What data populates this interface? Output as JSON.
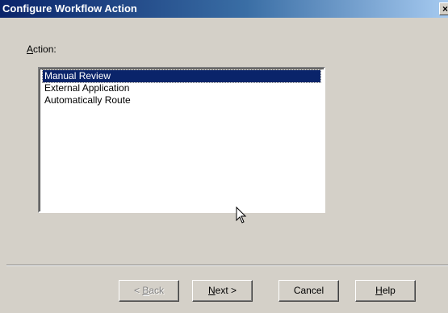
{
  "window": {
    "title": "Configure Workflow Action",
    "close_glyph": "×"
  },
  "action": {
    "label_prefix": "A",
    "label_rest": "ction:",
    "items": [
      {
        "label": "Manual Review",
        "selected": true
      },
      {
        "label": "External Application",
        "selected": false
      },
      {
        "label": "Automatically Route",
        "selected": false
      }
    ]
  },
  "buttons": {
    "back_prefix": "< ",
    "back_mnemonic": "B",
    "back_rest": "ack",
    "next_mnemonic": "N",
    "next_rest": "ext >",
    "cancel": "Cancel",
    "help_mnemonic": "H",
    "help_rest": "elp"
  },
  "colors": {
    "titlebar": "#0a246a",
    "selection": "#0a246a",
    "face": "#d4d0c8"
  },
  "icons": {
    "close": "close-icon",
    "cursor": "mouse-pointer-icon"
  }
}
